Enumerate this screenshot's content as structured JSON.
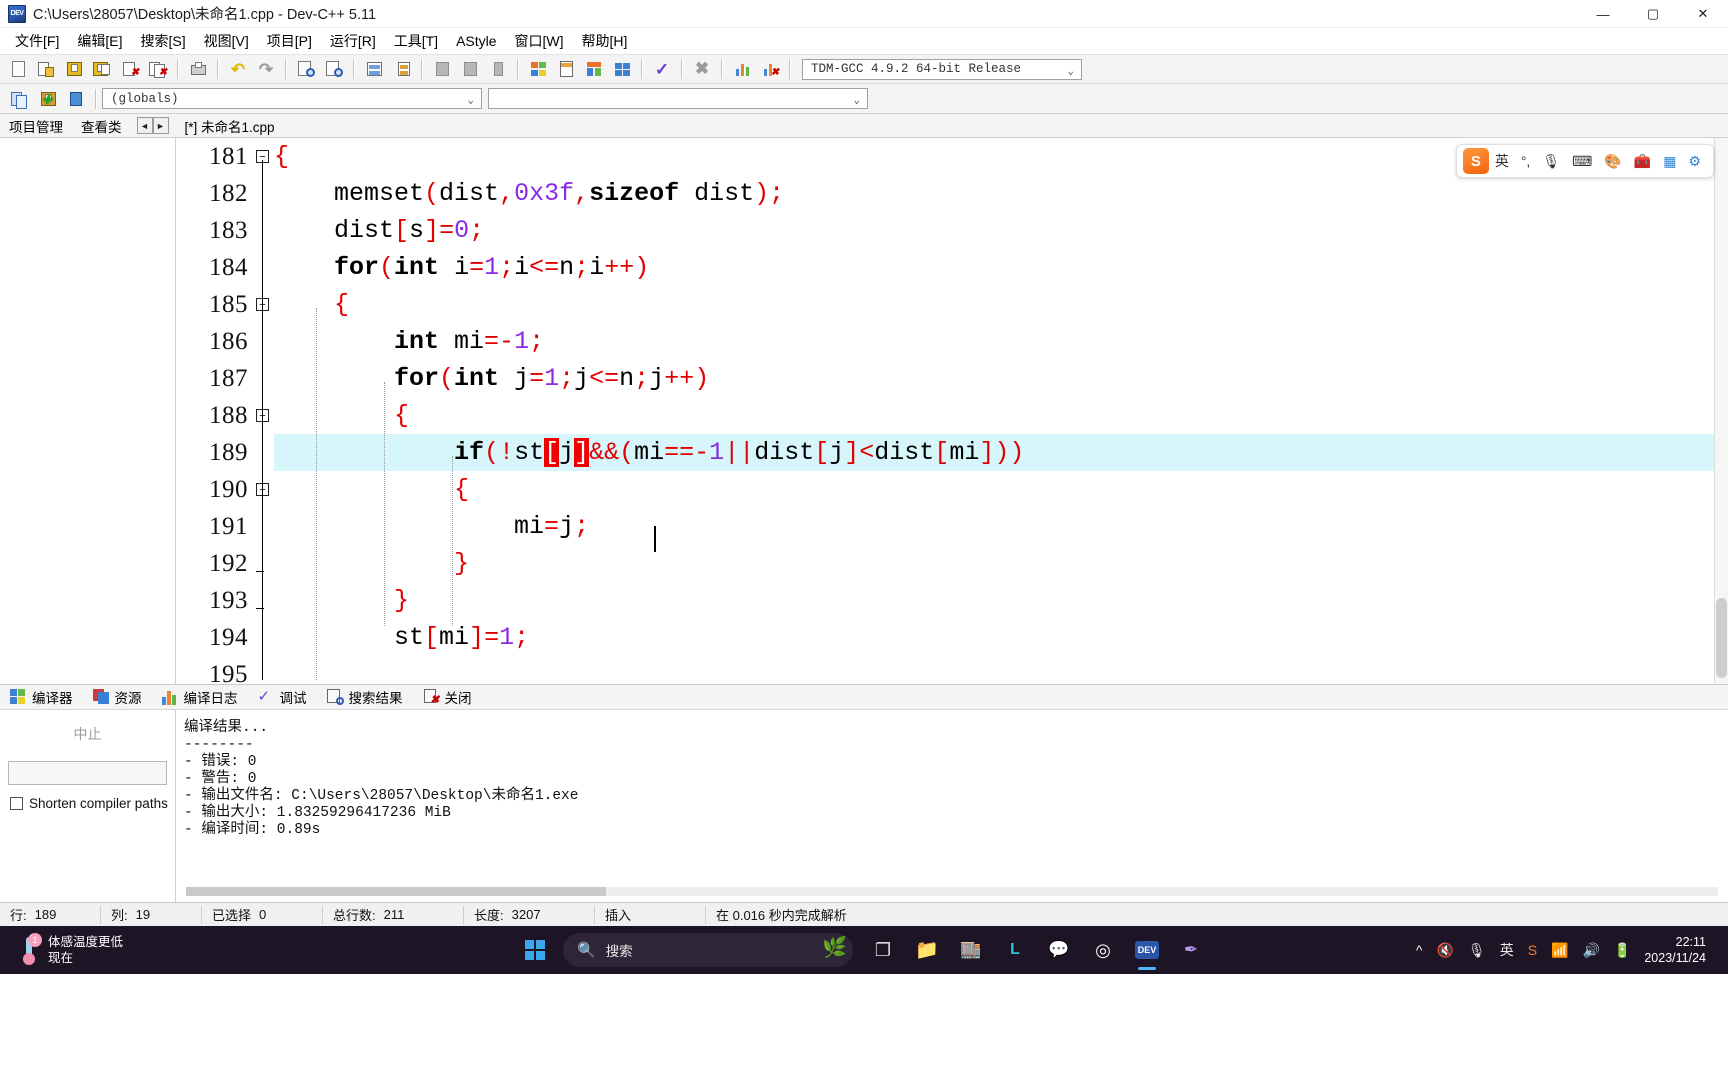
{
  "window": {
    "title": "C:\\Users\\28057\\Desktop\\未命名1.cpp - Dev-C++ 5.11",
    "app_icon": "dev-cpp-icon",
    "minimize": "—",
    "maximize": "▢",
    "close": "✕"
  },
  "menubar": {
    "items": [
      {
        "label": "文件[F]",
        "name": "menu-file"
      },
      {
        "label": "编辑[E]",
        "name": "menu-edit"
      },
      {
        "label": "搜索[S]",
        "name": "menu-search"
      },
      {
        "label": "视图[V]",
        "name": "menu-view"
      },
      {
        "label": "项目[P]",
        "name": "menu-project"
      },
      {
        "label": "运行[R]",
        "name": "menu-run"
      },
      {
        "label": "工具[T]",
        "name": "menu-tools"
      },
      {
        "label": "AStyle",
        "name": "menu-astyle"
      },
      {
        "label": "窗口[W]",
        "name": "menu-window"
      },
      {
        "label": "帮助[H]",
        "name": "menu-help"
      }
    ]
  },
  "toolbar": {
    "compiler_select": "TDM-GCC 4.9.2 64-bit Release",
    "compiler_arrow": "⌄"
  },
  "classbrowser": {
    "scope_select": "(globals)",
    "scope_arrow": "⌄",
    "member_select": "",
    "member_arrow": "⌄"
  },
  "tabstrip": {
    "project_manager": "项目管理",
    "class_view": "查看类",
    "nav_prev": "◄",
    "nav_next": "►",
    "file_tab": "[*] 未命名1.cpp"
  },
  "ime": {
    "logo": "S",
    "mode": "英",
    "punct": "°,",
    "mic_icon": "microphone-icon",
    "keyboard_icon": "keyboard-icon",
    "emoji_icon": "emoji-icon",
    "tools_icon": "toolbox-icon",
    "grid_icon": "grid-icon",
    "settings_icon": "settings-icon"
  },
  "editor": {
    "first_line": 181,
    "lines": [
      {
        "n": "181",
        "fold": "minus",
        "indent": 0,
        "tokens": [
          {
            "t": "{",
            "c": "op"
          }
        ]
      },
      {
        "n": "182",
        "fold": "",
        "indent": 0,
        "tokens": [
          {
            "t": "    memset",
            "c": "id"
          },
          {
            "t": "(",
            "c": "op"
          },
          {
            "t": "dist",
            "c": "id"
          },
          {
            "t": ",",
            "c": "op"
          },
          {
            "t": "0x3f",
            "c": "num"
          },
          {
            "t": ",",
            "c": "op"
          },
          {
            "t": "sizeof",
            "c": "kw"
          },
          {
            "t": " dist",
            "c": "id"
          },
          {
            "t": ")",
            "c": "op"
          },
          {
            "t": ";",
            "c": "op"
          }
        ]
      },
      {
        "n": "183",
        "fold": "",
        "indent": 0,
        "tokens": [
          {
            "t": "    dist",
            "c": "id"
          },
          {
            "t": "[",
            "c": "op"
          },
          {
            "t": "s",
            "c": "id"
          },
          {
            "t": "]",
            "c": "op"
          },
          {
            "t": "=",
            "c": "op"
          },
          {
            "t": "0",
            "c": "num"
          },
          {
            "t": ";",
            "c": "op"
          }
        ]
      },
      {
        "n": "184",
        "fold": "",
        "indent": 0,
        "tokens": [
          {
            "t": "    for",
            "c": "kw"
          },
          {
            "t": "(",
            "c": "op"
          },
          {
            "t": "int",
            "c": "kw"
          },
          {
            "t": " i",
            "c": "id"
          },
          {
            "t": "=",
            "c": "op"
          },
          {
            "t": "1",
            "c": "num"
          },
          {
            "t": ";",
            "c": "op"
          },
          {
            "t": "i",
            "c": "id"
          },
          {
            "t": "<=",
            "c": "op"
          },
          {
            "t": "n",
            "c": "id"
          },
          {
            "t": ";",
            "c": "op"
          },
          {
            "t": "i",
            "c": "id"
          },
          {
            "t": "++",
            "c": "op"
          },
          {
            "t": ")",
            "c": "op"
          }
        ]
      },
      {
        "n": "185",
        "fold": "minus",
        "indent": 0,
        "tokens": [
          {
            "t": "    {",
            "c": "op"
          }
        ]
      },
      {
        "n": "186",
        "fold": "",
        "indent": 0,
        "tokens": [
          {
            "t": "        int",
            "c": "kw"
          },
          {
            "t": " mi",
            "c": "id"
          },
          {
            "t": "=-",
            "c": "op"
          },
          {
            "t": "1",
            "c": "num"
          },
          {
            "t": ";",
            "c": "op"
          }
        ]
      },
      {
        "n": "187",
        "fold": "",
        "indent": 0,
        "tokens": [
          {
            "t": "        for",
            "c": "kw"
          },
          {
            "t": "(",
            "c": "op"
          },
          {
            "t": "int",
            "c": "kw"
          },
          {
            "t": " j",
            "c": "id"
          },
          {
            "t": "=",
            "c": "op"
          },
          {
            "t": "1",
            "c": "num"
          },
          {
            "t": ";",
            "c": "op"
          },
          {
            "t": "j",
            "c": "id"
          },
          {
            "t": "<=",
            "c": "op"
          },
          {
            "t": "n",
            "c": "id"
          },
          {
            "t": ";",
            "c": "op"
          },
          {
            "t": "j",
            "c": "id"
          },
          {
            "t": "++",
            "c": "op"
          },
          {
            "t": ")",
            "c": "op"
          }
        ]
      },
      {
        "n": "188",
        "fold": "minus",
        "indent": 0,
        "tokens": [
          {
            "t": "        {",
            "c": "op"
          }
        ]
      },
      {
        "n": "189",
        "fold": "",
        "highlight": true,
        "indent": 0,
        "tokens": [
          {
            "t": "            if",
            "c": "kw"
          },
          {
            "t": "(!",
            "c": "op"
          },
          {
            "t": "st",
            "c": "id"
          },
          {
            "t": "[",
            "c": "brk"
          },
          {
            "t": "j",
            "c": "id"
          },
          {
            "t": "]",
            "c": "brk"
          },
          {
            "t": "&&(",
            "c": "op"
          },
          {
            "t": "mi",
            "c": "id"
          },
          {
            "t": "==-",
            "c": "op"
          },
          {
            "t": "1",
            "c": "num"
          },
          {
            "t": "||",
            "c": "op"
          },
          {
            "t": "dist",
            "c": "id"
          },
          {
            "t": "[",
            "c": "op"
          },
          {
            "t": "j",
            "c": "id"
          },
          {
            "t": "]",
            "c": "op"
          },
          {
            "t": "<",
            "c": "op"
          },
          {
            "t": "dist",
            "c": "id"
          },
          {
            "t": "[",
            "c": "op"
          },
          {
            "t": "mi",
            "c": "id"
          },
          {
            "t": "]",
            "c": "op"
          },
          {
            "t": "))",
            "c": "op"
          }
        ]
      },
      {
        "n": "190",
        "fold": "minus",
        "indent": 0,
        "tokens": [
          {
            "t": "            {",
            "c": "op"
          }
        ]
      },
      {
        "n": "191",
        "fold": "",
        "indent": 0,
        "tokens": [
          {
            "t": "                mi",
            "c": "id"
          },
          {
            "t": "=",
            "c": "op"
          },
          {
            "t": "j",
            "c": "id"
          },
          {
            "t": ";",
            "c": "op"
          }
        ]
      },
      {
        "n": "192",
        "fold": "dash",
        "indent": 0,
        "tokens": [
          {
            "t": "            }",
            "c": "op"
          }
        ]
      },
      {
        "n": "193",
        "fold": "dash",
        "indent": 0,
        "tokens": [
          {
            "t": "        }",
            "c": "op"
          }
        ]
      },
      {
        "n": "194",
        "fold": "",
        "indent": 0,
        "tokens": [
          {
            "t": "        st",
            "c": "id"
          },
          {
            "t": "[",
            "c": "op"
          },
          {
            "t": "mi",
            "c": "id"
          },
          {
            "t": "]",
            "c": "op"
          },
          {
            "t": "=",
            "c": "op"
          },
          {
            "t": "1",
            "c": "num"
          },
          {
            "t": ";",
            "c": "op"
          }
        ]
      },
      {
        "n": "195",
        "fold": "",
        "indent": 0,
        "tokens": []
      }
    ]
  },
  "panel": {
    "tabs": [
      {
        "label": "编译器",
        "icon": "compiler-icon",
        "name": "panel-tab-compiler"
      },
      {
        "label": "资源",
        "icon": "resources-icon",
        "name": "panel-tab-resources"
      },
      {
        "label": "编译日志",
        "icon": "log-icon",
        "name": "panel-tab-compile-log"
      },
      {
        "label": "调试",
        "icon": "debug-icon",
        "name": "panel-tab-debug"
      },
      {
        "label": "搜索结果",
        "icon": "find-results-icon",
        "name": "panel-tab-find-results"
      },
      {
        "label": "关闭",
        "icon": "close-panel-icon",
        "name": "panel-tab-close"
      }
    ],
    "abort_label": "中止",
    "progress_value": "",
    "shorten_label": "Shorten compiler paths",
    "shorten_checked": false,
    "log": [
      "编译结果...",
      "--------",
      "- 错误: 0",
      "- 警告: 0",
      "- 输出文件名: C:\\Users\\28057\\Desktop\\未命名1.exe",
      "- 输出大小: 1.83259296417236 MiB",
      "- 编译时间: 0.89s"
    ]
  },
  "statusbar": {
    "cells": [
      {
        "label": "行:",
        "value": "189",
        "name": "status-row"
      },
      {
        "label": "列:",
        "value": "19",
        "name": "status-col"
      },
      {
        "label": "已选择",
        "value": "0",
        "name": "status-selected"
      },
      {
        "label": "总行数:",
        "value": "211",
        "name": "status-total-lines"
      },
      {
        "label": "长度:",
        "value": "3207",
        "name": "status-length"
      },
      {
        "label": "插入",
        "value": "",
        "name": "status-insert-mode"
      },
      {
        "label": "在 0.016 秒内完成解析",
        "value": "",
        "name": "status-parse-time"
      }
    ]
  },
  "taskbar": {
    "weather_title": "体感温度更低",
    "weather_sub": "现在",
    "weather_badge": "1",
    "start_icon": "windows-start-icon",
    "search_icon": "search-icon",
    "search_placeholder": "搜索",
    "apps": [
      {
        "name": "taskview-icon",
        "glyph": "❐",
        "active": false
      },
      {
        "name": "file-explorer-icon",
        "glyph": "📁",
        "active": false
      },
      {
        "name": "store-icon",
        "glyph": "🏬",
        "active": false
      },
      {
        "name": "lark-icon",
        "glyph": "L",
        "active": false
      },
      {
        "name": "wechat-icon",
        "glyph": "💬",
        "active": false
      },
      {
        "name": "chrome-icon",
        "glyph": "◎",
        "active": false
      },
      {
        "name": "devcpp-icon",
        "glyph": "DEV",
        "active": true
      },
      {
        "name": "feather-icon",
        "glyph": "✒",
        "active": false
      }
    ],
    "tray": {
      "chevron": "^",
      "sound_mute_icon": "sound-mute-icon",
      "mic_icon": "microphone-icon",
      "ime_label": "英",
      "sogou_icon": "sogou-icon",
      "wifi_icon": "wifi-icon",
      "volume_icon": "volume-icon",
      "battery_icon": "battery-icon",
      "time": "22:11",
      "date": "2023/11/24"
    }
  }
}
